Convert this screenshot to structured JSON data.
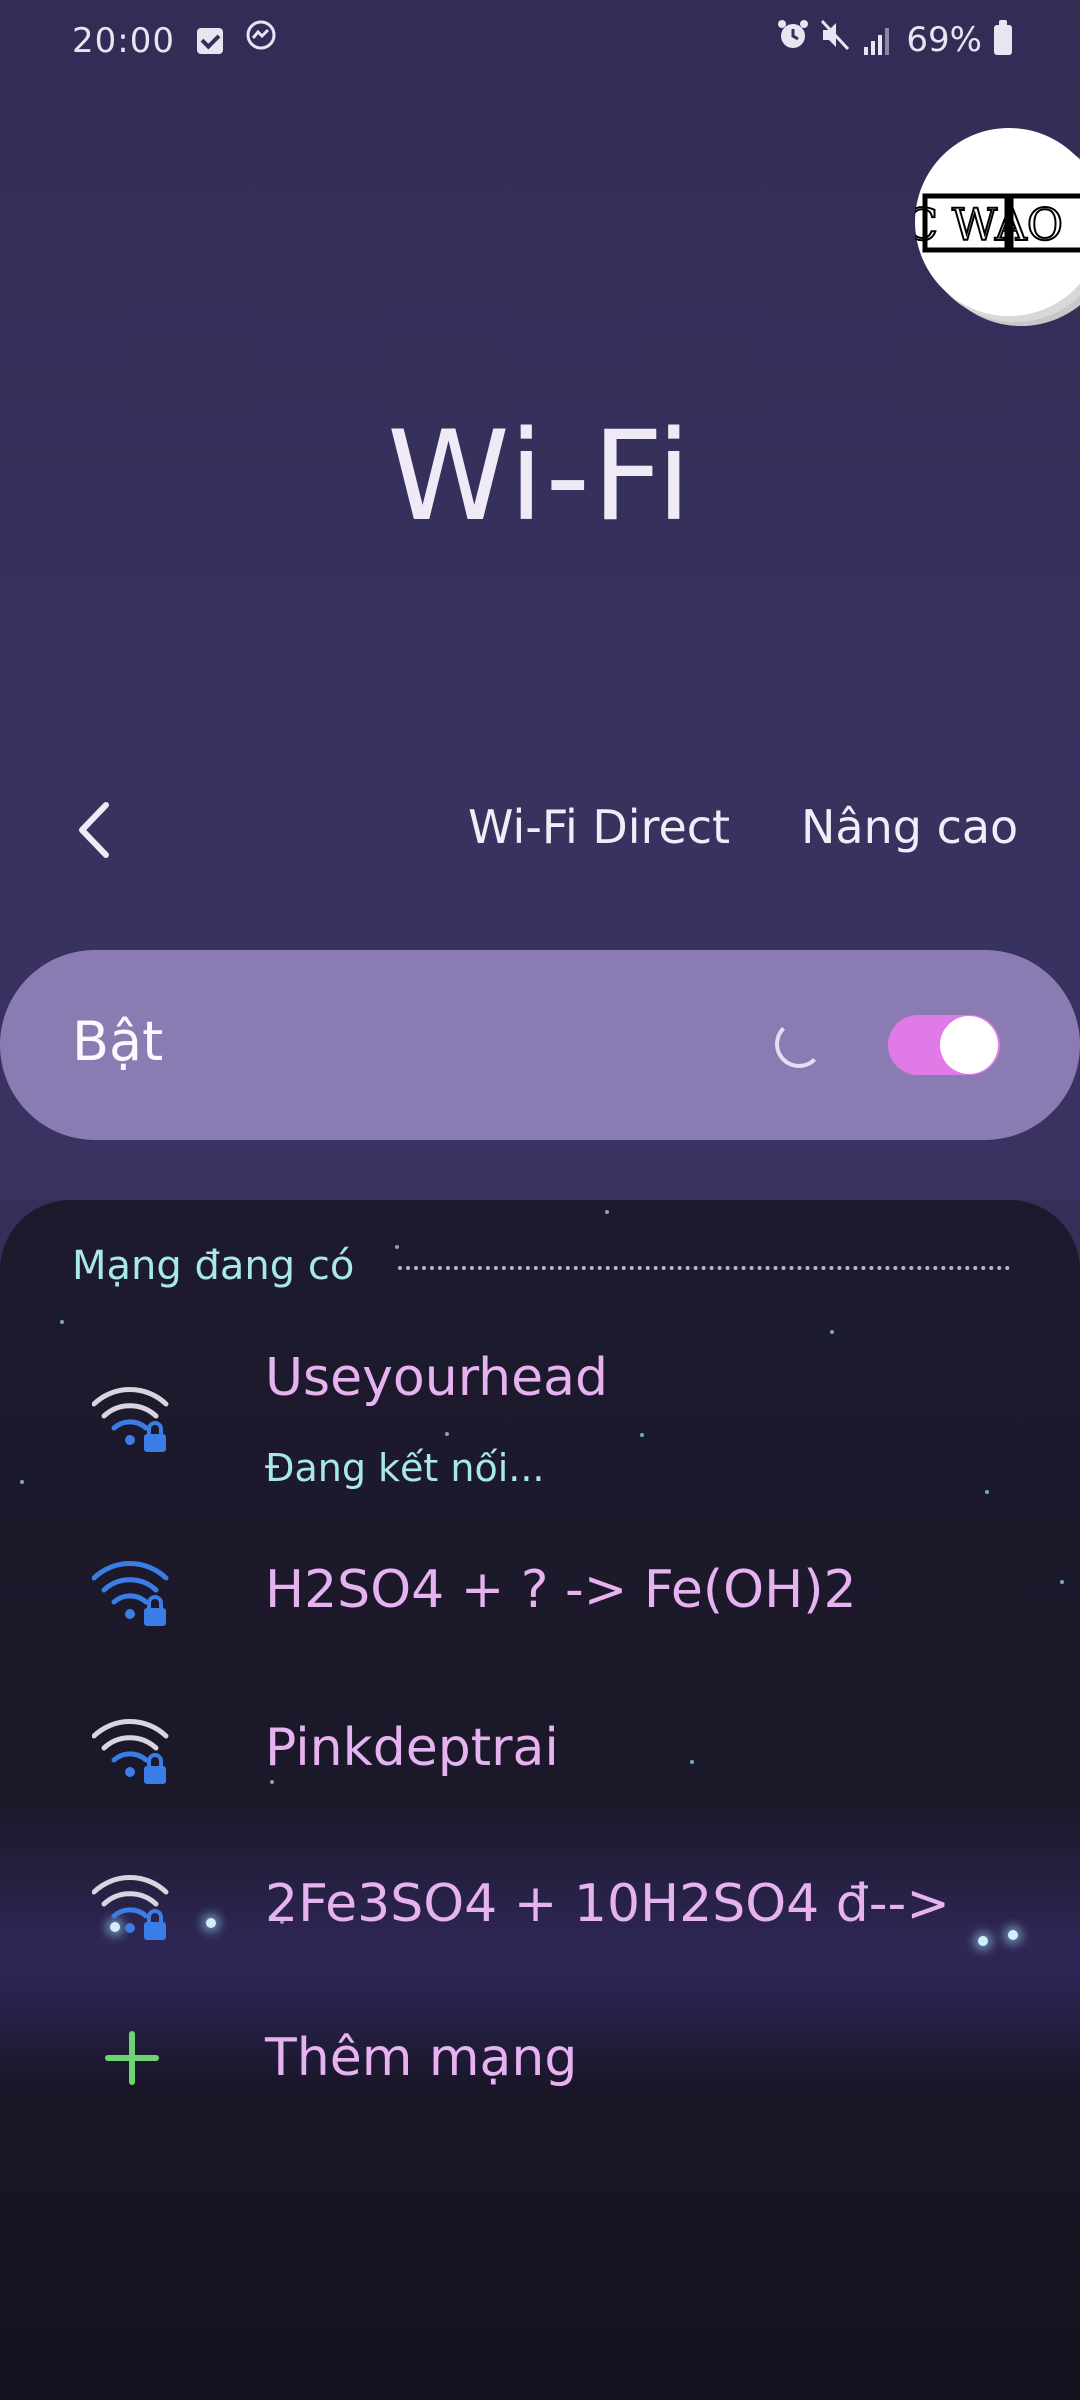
{
  "status_bar": {
    "time": "20:00",
    "battery": "69%",
    "icons": [
      "checkbox-notification-icon",
      "messenger-icon",
      "alarm-icon",
      "mute-icon",
      "signal-icon",
      "battery-icon"
    ]
  },
  "logo": {
    "text": "DC WAO"
  },
  "page": {
    "title": "Wi-Fi"
  },
  "action_bar": {
    "back_icon": "chevron-left-icon",
    "wifi_direct_label": "Wi-Fi Direct",
    "advanced_label": "Nâng cao"
  },
  "master_switch": {
    "label": "Bật",
    "state": "on",
    "loading": true
  },
  "networks": {
    "header": "Mạng đang có",
    "items": [
      {
        "name": "Useyourhead",
        "status": "Đang kết nối...",
        "signal": "weak",
        "icon_color": "#d9d4e0",
        "secured": true
      },
      {
        "name": "H2SO4 + ? -> Fe(OH)2",
        "status": "",
        "signal": "full",
        "icon_color": "#3a7de6",
        "secured": true
      },
      {
        "name": "Pinkdeptrai",
        "status": "",
        "signal": "weak",
        "icon_color": "#d9d4e0",
        "secured": true
      },
      {
        "name": "2Fe3SO4 + 10H2SO4 đ-->",
        "status": "",
        "signal": "weak",
        "icon_color": "#d9d4e0",
        "secured": true
      }
    ],
    "add_label": "Thêm mạng"
  },
  "colors": {
    "accent_pink": "#e07ae6",
    "network_name": "#e6b2f0",
    "section_header": "#a8e8e6",
    "wifi_blue": "#3a7de6",
    "add_green": "#6fd46f"
  }
}
